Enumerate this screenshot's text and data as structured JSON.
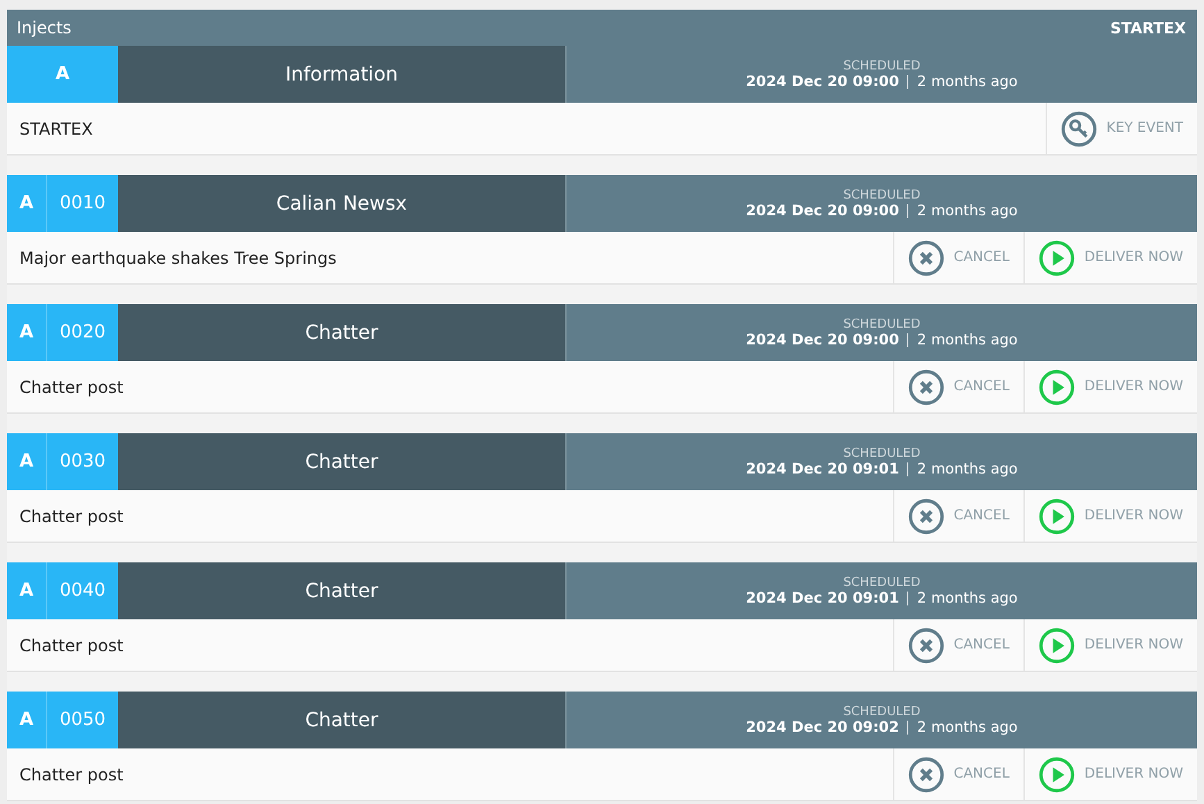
{
  "header": {
    "title": "Injects",
    "exercise": "STARTEX"
  },
  "injects": [
    {
      "track": "A",
      "title": "Information",
      "status": "SCHEDULED",
      "date": "2024 Dec 20 09:00",
      "relative": "2 months ago",
      "description": "STARTEX",
      "actions": [
        {
          "kind": "key_event",
          "label": "KEY EVENT"
        }
      ]
    },
    {
      "track": "A",
      "number": "0010",
      "title": "Calian Newsx",
      "status": "SCHEDULED",
      "date": "2024 Dec 20 09:00",
      "relative": "2 months ago",
      "description": "Major earthquake shakes Tree Springs",
      "actions": [
        {
          "kind": "cancel",
          "label": "CANCEL"
        },
        {
          "kind": "deliver",
          "label": "DELIVER NOW"
        }
      ]
    },
    {
      "track": "A",
      "number": "0020",
      "title": "Chatter",
      "status": "SCHEDULED",
      "date": "2024 Dec 20 09:00",
      "relative": "2 months ago",
      "description": "Chatter post",
      "actions": [
        {
          "kind": "cancel",
          "label": "CANCEL"
        },
        {
          "kind": "deliver",
          "label": "DELIVER NOW"
        }
      ]
    },
    {
      "track": "A",
      "number": "0030",
      "title": "Chatter",
      "status": "SCHEDULED",
      "date": "2024 Dec 20 09:01",
      "relative": "2 months ago",
      "description": "Chatter post",
      "actions": [
        {
          "kind": "cancel",
          "label": "CANCEL"
        },
        {
          "kind": "deliver",
          "label": "DELIVER NOW"
        }
      ]
    },
    {
      "track": "A",
      "number": "0040",
      "title": "Chatter",
      "status": "SCHEDULED",
      "date": "2024 Dec 20 09:01",
      "relative": "2 months ago",
      "description": "Chatter post",
      "actions": [
        {
          "kind": "cancel",
          "label": "CANCEL"
        },
        {
          "kind": "deliver",
          "label": "DELIVER NOW"
        }
      ]
    },
    {
      "track": "A",
      "number": "0050",
      "title": "Chatter",
      "status": "SCHEDULED",
      "date": "2024 Dec 20 09:02",
      "relative": "2 months ago",
      "description": "Chatter post",
      "actions": [
        {
          "kind": "cancel",
          "label": "CANCEL"
        },
        {
          "kind": "deliver",
          "label": "DELIVER NOW"
        }
      ]
    }
  ]
}
